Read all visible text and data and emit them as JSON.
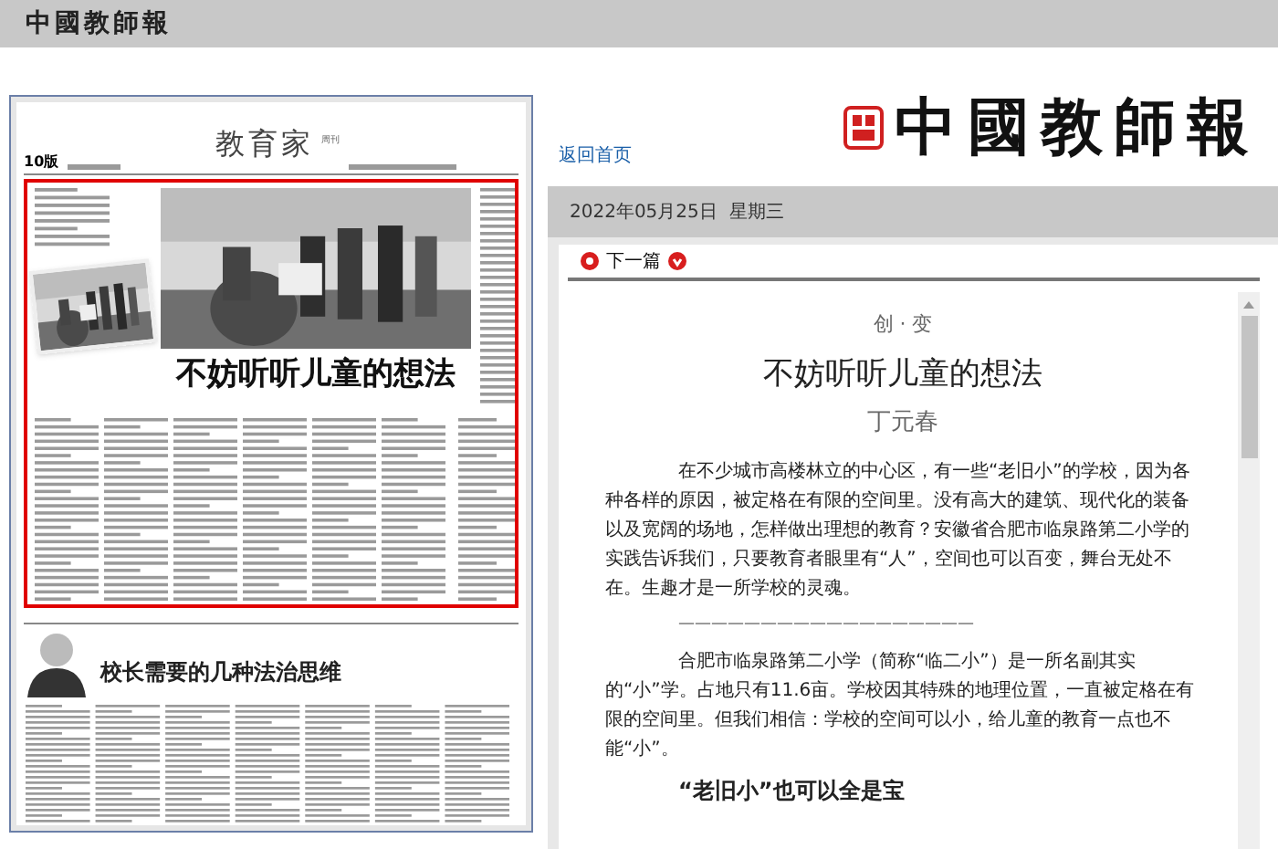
{
  "top_bar": {
    "logo": "中國教師報"
  },
  "newspaper_page": {
    "page_number": "10版",
    "section": "教育家",
    "section_note": "周刊",
    "highlighted_article": {
      "selected": true,
      "headline": "不妨听听儿童的想法"
    },
    "second_article": {
      "headline": "校长需要的几种法治思维"
    }
  },
  "home_link": "返回首页",
  "masthead": {
    "logo": "中國教師報"
  },
  "date_bar": {
    "date": "2022年05月25日  星期三"
  },
  "nav": {
    "next": "下一篇"
  },
  "article": {
    "kicker": "创 · 变",
    "title": "不妨听听儿童的想法",
    "author": "丁元春",
    "paragraphs": [
      {
        "kind": "text",
        "text": "在不少城市高楼林立的中心区，有一些“老旧小”的学校，因为各种各样的原因，被定格在有限的空间里。没有高大的建筑、现代化的装备以及宽阔的场地，怎样做出理想的教育？安徽省合肥市临泉路第二小学的实践告诉我们，只要教育者眼里有“人”，空间也可以百变，舞台无处不在。生趣才是一所学校的灵魂。"
      },
      {
        "kind": "divider",
        "text": "——————————————————"
      },
      {
        "kind": "text",
        "text": "合肥市临泉路第二小学（简称“临二小”）是一所名副其实的“小”学。占地只有11.6亩。学校因其特殊的地理位置，一直被定格在有限的空间里。但我们相信：学校的空间可以小，给儿童的教育一点也不能“小”。"
      },
      {
        "kind": "heading",
        "text": "“老旧小”也可以全是宝"
      }
    ]
  }
}
